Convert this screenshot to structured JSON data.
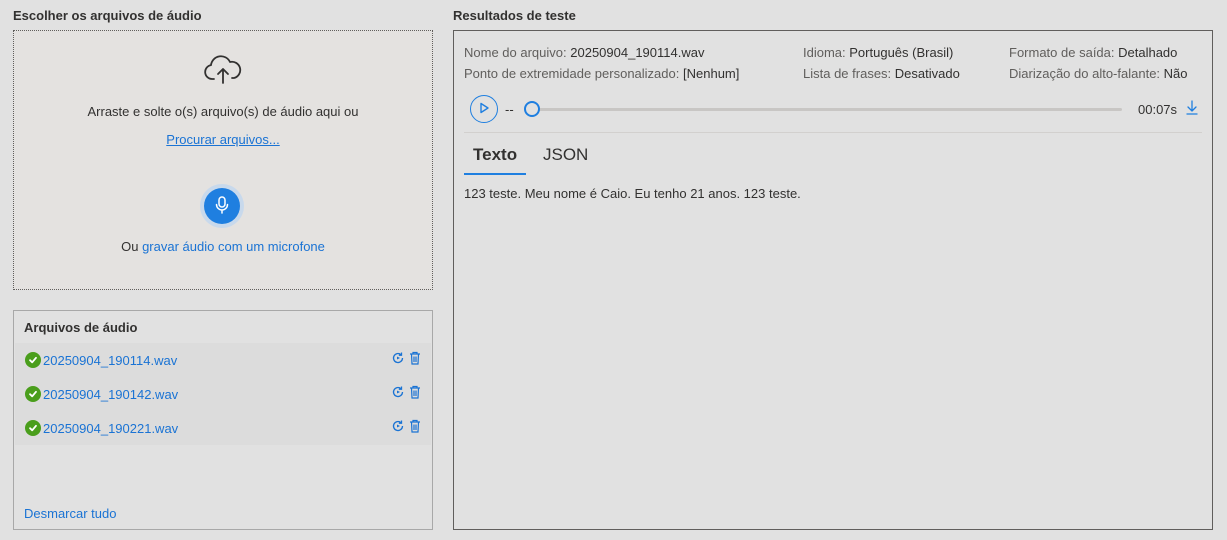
{
  "upload": {
    "title": "Escolher os arquivos de áudio",
    "drop_text": "Arraste e solte o(s) arquivo(s) de áudio aqui ou",
    "browse_link": "Procurar arquivos...",
    "mic_prefix": "Ou",
    "mic_link": "gravar áudio com um microfone"
  },
  "files": {
    "title": "Arquivos de áudio",
    "items": [
      {
        "name": "20250904_190114.wav"
      },
      {
        "name": "20250904_190142.wav"
      },
      {
        "name": "20250904_190221.wav"
      }
    ],
    "deselect_all": "Desmarcar tudo"
  },
  "results": {
    "title": "Resultados de teste",
    "meta": {
      "file_name_label": "Nome do arquivo:",
      "file_name_value": "20250904_190114.wav",
      "endpoint_label": "Ponto de extremidade personalizado:",
      "endpoint_value": "[Nenhum]",
      "language_label": "Idioma:",
      "language_value": "Português (Brasil)",
      "phrase_list_label": "Lista de frases:",
      "phrase_list_value": "Desativado",
      "output_format_label": "Formato de saída:",
      "output_format_value": "Detalhado",
      "diarization_label": "Diarização do alto-falante:",
      "diarization_value": "Não"
    },
    "player": {
      "current_time": "--",
      "total_time": "00:07s",
      "progress": 0
    },
    "tabs": [
      {
        "label": "Texto",
        "active": true
      },
      {
        "label": "JSON",
        "active": false
      }
    ],
    "text": "123 teste. Meu nome é Caio. Eu tenho 21 anos. 123 teste."
  },
  "colors": {
    "accent": "#1f7fe0",
    "link": "#1a73d4",
    "success": "#4a9e1c",
    "background": "#e1e1e1"
  },
  "icons": [
    "cloud-upload-icon",
    "microphone-icon",
    "check-circle-icon",
    "refresh-icon",
    "trash-icon",
    "play-icon",
    "download-icon"
  ]
}
